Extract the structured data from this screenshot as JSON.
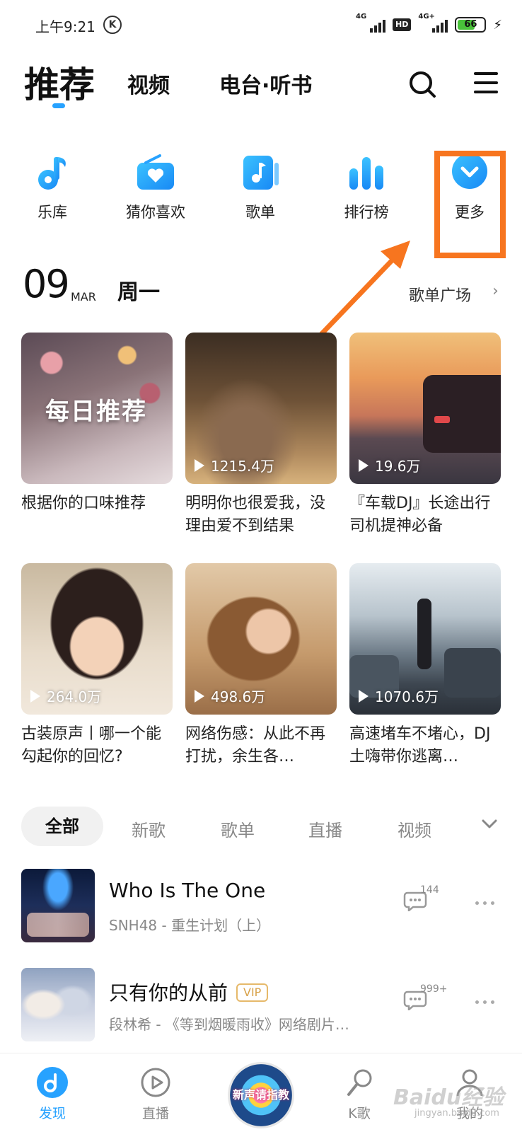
{
  "status_bar": {
    "time": "上午9:21",
    "k_badge": "K",
    "network_1": "4G",
    "hd": "HD",
    "network_2": "4G+",
    "battery": "66"
  },
  "header": {
    "tabs": [
      {
        "label": "推荐",
        "active": true
      },
      {
        "label": "视频"
      },
      {
        "label": "电台·听书"
      }
    ]
  },
  "shortcuts": [
    {
      "label": "乐库",
      "icon": "music-note-icon"
    },
    {
      "label": "猜你喜欢",
      "icon": "heart-radio-icon"
    },
    {
      "label": "歌单",
      "icon": "playlist-icon"
    },
    {
      "label": "排行榜",
      "icon": "bar-chart-icon"
    },
    {
      "label": "更多",
      "icon": "chevron-down-circle-icon"
    }
  ],
  "date_row": {
    "day": "09",
    "month": "MAR",
    "weekday": "周一",
    "plaza_link": "歌单广场"
  },
  "cards": [
    {
      "title": "根据你的口味推荐",
      "overlay": "每日推荐"
    },
    {
      "title": "明明你也很爱我，没理由爱不到结果",
      "plays": "1215.4万"
    },
    {
      "title": "『车载DJ』长途出行司机提神必备",
      "plays": "19.6万"
    },
    {
      "title": "古装原声丨哪一个能勾起你的回忆?",
      "plays": "264.0万"
    },
    {
      "title": "网络伤感：从此不再打扰，余生各…",
      "plays": "498.6万"
    },
    {
      "title": "高速堵车不堵心，DJ土嗨带你逃离…",
      "plays": "1070.6万"
    }
  ],
  "filters": [
    "全部",
    "新歌",
    "歌单",
    "直播",
    "视频"
  ],
  "songs": [
    {
      "name": "Who Is The One",
      "sub": "SNH48 - 重生计划（上）",
      "comments": "144"
    },
    {
      "name": "只有你的从前",
      "vip": "VIP",
      "sub": "段林希 - 《等到烟暖雨收》网络剧片…",
      "comments": "999+"
    }
  ],
  "bottom_nav": [
    {
      "label": "发现",
      "active": true
    },
    {
      "label": "直播"
    },
    {
      "label": "新声请指教",
      "center": true
    },
    {
      "label": "K歌"
    },
    {
      "label": "我的"
    }
  ],
  "watermark": {
    "text": "Baidu经验",
    "sub": "jingyan.baidu.com"
  },
  "colors": {
    "accent": "#27a2ff",
    "highlight": "#f7751f",
    "vip": "#d8a24a"
  }
}
